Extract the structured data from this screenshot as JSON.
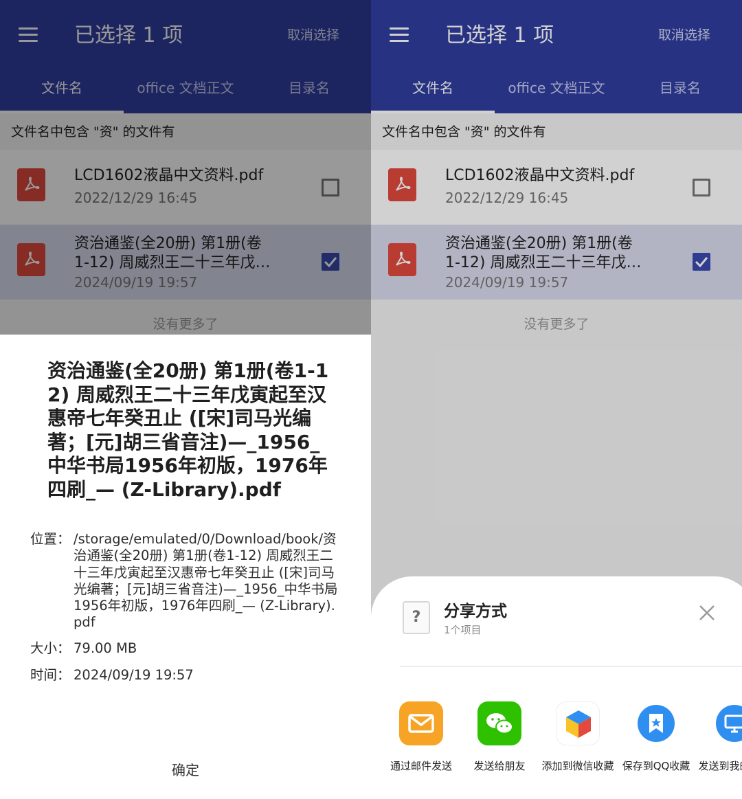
{
  "colors": {
    "appbar": "#303F9F",
    "appbar_dimmed": "#1C2560",
    "accent": "#3A4AB0",
    "page_bg": "#F5F5F5",
    "selected_row": "#D9DCEE",
    "pdf_red": "#E24A3F"
  },
  "header": {
    "title": "已选择 1 项",
    "cancel_label": "取消选择"
  },
  "tabs": [
    {
      "label": "文件名",
      "active": true
    },
    {
      "label": "office 文档正文",
      "active": false
    },
    {
      "label": "目录名",
      "active": false
    }
  ],
  "hint": "文件名中包含 \"资\" 的文件有",
  "files": [
    {
      "name": "LCD1602液晶中文资料.pdf",
      "name_line2": "",
      "date": "2022/12/29  16:45",
      "checked": false,
      "icon": "pdf-icon"
    },
    {
      "name": "资治通鉴(全20册) 第1册(卷",
      "name_line2": "1-12) 周威烈王二十三年戊…",
      "date": "2024/09/19  19:57",
      "checked": true,
      "icon": "pdf-icon"
    }
  ],
  "no_more": "没有更多了",
  "dialog": {
    "title": "资治通鉴(全20册) 第1册(卷1-12) 周威烈王二十三年戊寅起至汉惠帝七年癸丑止 ([宋]司马光编著；[元]胡三省音注)—_1956_中华书局1956年初版，1976年四刷_— (Z-Library).pdf",
    "location_key": "位置：",
    "location_value": "/storage/emulated/0/Download/book/资治通鉴(全20册) 第1册(卷1-12) 周威烈王二十三年戊寅起至汉惠帝七年癸丑止 ([宋]司马光编著；[元]胡三省音注)—_1956_中华书局1956年初版，1976年四刷_— (Z-Library).pdf",
    "size_key": "大小：",
    "size_value": "79.00 MB",
    "time_key": "时间：",
    "time_value": "2024/09/19  19:57",
    "ok_label": "确定"
  },
  "share": {
    "title": "分享方式",
    "subtitle": "1个项目",
    "file_icon": "unknown-file-icon",
    "apps": [
      {
        "label": "通过邮件发送",
        "icon": "mail-icon",
        "color": "#F7A325"
      },
      {
        "label": "发送给朋友",
        "icon": "wechat-icon",
        "color": "#2DC100"
      },
      {
        "label": "添加到微信收藏",
        "icon": "wechat-favorites-icon",
        "color": "#FFFFFF"
      },
      {
        "label": "保存到QQ收藏",
        "icon": "qq-favorites-icon",
        "color": "#2F8FF0"
      },
      {
        "label": "发送到我的电脑",
        "icon": "computer-icon",
        "color": "#2F8FF0"
      }
    ]
  }
}
